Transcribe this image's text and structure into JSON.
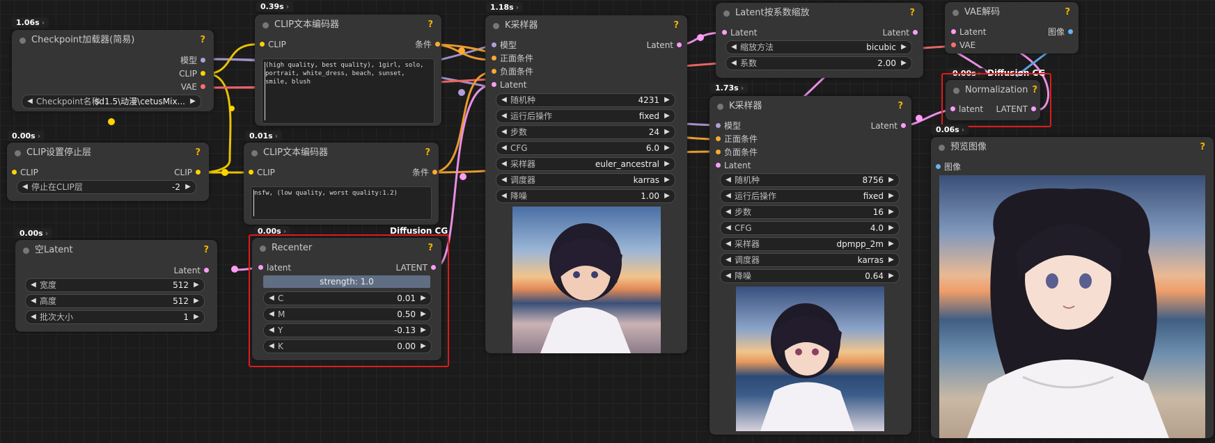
{
  "nodes": {
    "checkpoint": {
      "time": "1.06s",
      "title": "Checkpoint加载器(简易)",
      "help": "?",
      "outputs": [
        "模型",
        "CLIP",
        "VAE"
      ],
      "ckpt": {
        "label": "Checkpoint名称",
        "value": "sd1.5\\动漫\\cetusMix..."
      }
    },
    "clip_stop": {
      "time": "0.00s",
      "title": "CLIP设置停止层",
      "help": "?",
      "input": "CLIP",
      "output": "CLIP",
      "stop": {
        "label": "停止在CLIP层",
        "value": "-2"
      }
    },
    "empty_latent": {
      "time": "0.00s",
      "title": "空Latent",
      "help": "?",
      "output": "Latent",
      "width": {
        "label": "宽度",
        "value": "512"
      },
      "height": {
        "label": "高度",
        "value": "512"
      },
      "batch": {
        "label": "批次大小",
        "value": "1"
      }
    },
    "clip_pos": {
      "time": "0.39s",
      "title": "CLIP文本编码器",
      "help": "?",
      "input": "CLIP",
      "output": "条件",
      "text": "(high quality, best quality), 1girl, solo,\nportrait, white_dress, beach, sunset, smile, blush"
    },
    "clip_neg": {
      "time": "0.01s",
      "title": "CLIP文本编码器",
      "help": "?",
      "input": "CLIP",
      "output": "条件",
      "text": "nsfw, (low quality, worst quality:1.2)"
    },
    "recenter": {
      "time": "0.00s",
      "tag": "Diffusion CG",
      "title": "Recenter",
      "help": "?",
      "input": "latent",
      "output": "LATENT",
      "strength": "strength: 1.0",
      "params": [
        {
          "label": "C",
          "value": "0.01"
        },
        {
          "label": "M",
          "value": "0.50"
        },
        {
          "label": "Y",
          "value": "-0.13"
        },
        {
          "label": "K",
          "value": "0.00"
        }
      ]
    },
    "ksampler1": {
      "time": "1.18s",
      "title": "K采样器",
      "help": "?",
      "inputs": [
        "模型",
        "正面条件",
        "负面条件",
        "Latent"
      ],
      "output": "Latent",
      "params": [
        {
          "label": "随机种",
          "value": "4231"
        },
        {
          "label": "运行后操作",
          "value": "fixed"
        },
        {
          "label": "步数",
          "value": "24"
        },
        {
          "label": "CFG",
          "value": "6.0"
        },
        {
          "label": "采样器",
          "value": "euler_ancestral"
        },
        {
          "label": "调度器",
          "value": "karras"
        },
        {
          "label": "降噪",
          "value": "1.00"
        }
      ]
    },
    "upscale": {
      "title": "Latent按系数缩放",
      "help": "?",
      "input": "Latent",
      "output": "Latent",
      "method": {
        "label": "缩放方法",
        "value": "bicubic"
      },
      "factor": {
        "label": "系数",
        "value": "2.00"
      }
    },
    "ksampler2": {
      "time": "1.73s",
      "title": "K采样器",
      "help": "?",
      "inputs": [
        "模型",
        "正面条件",
        "负面条件",
        "Latent"
      ],
      "output": "Latent",
      "params": [
        {
          "label": "随机种",
          "value": "8756"
        },
        {
          "label": "运行后操作",
          "value": "fixed"
        },
        {
          "label": "步数",
          "value": "16"
        },
        {
          "label": "CFG",
          "value": "4.0"
        },
        {
          "label": "采样器",
          "value": "dpmpp_2m"
        },
        {
          "label": "调度器",
          "value": "karras"
        },
        {
          "label": "降噪",
          "value": "0.64"
        }
      ]
    },
    "vae_decode": {
      "title": "VAE解码",
      "help": "?",
      "inputs": [
        "Latent",
        "VAE"
      ],
      "output": "图像"
    },
    "normalization": {
      "time": "0.00s",
      "tag": "Diffusion CG",
      "title": "Normalization",
      "help": "?",
      "input": "latent",
      "output": "LATENT"
    },
    "preview": {
      "time": "0.06s",
      "title": "预览图像",
      "help": "?",
      "input": "图像"
    }
  },
  "colors": {
    "model": "#b39ddb",
    "clip": "#ffd500",
    "vae": "#ff6e6e",
    "cond": "#ffa931",
    "latent": "#ff9cf9",
    "image": "#64b5f6",
    "highlight": "#e01b1b",
    "help": "#f0b400"
  },
  "icons": {
    "left_arrow": "◀",
    "right_arrow": "▶"
  }
}
